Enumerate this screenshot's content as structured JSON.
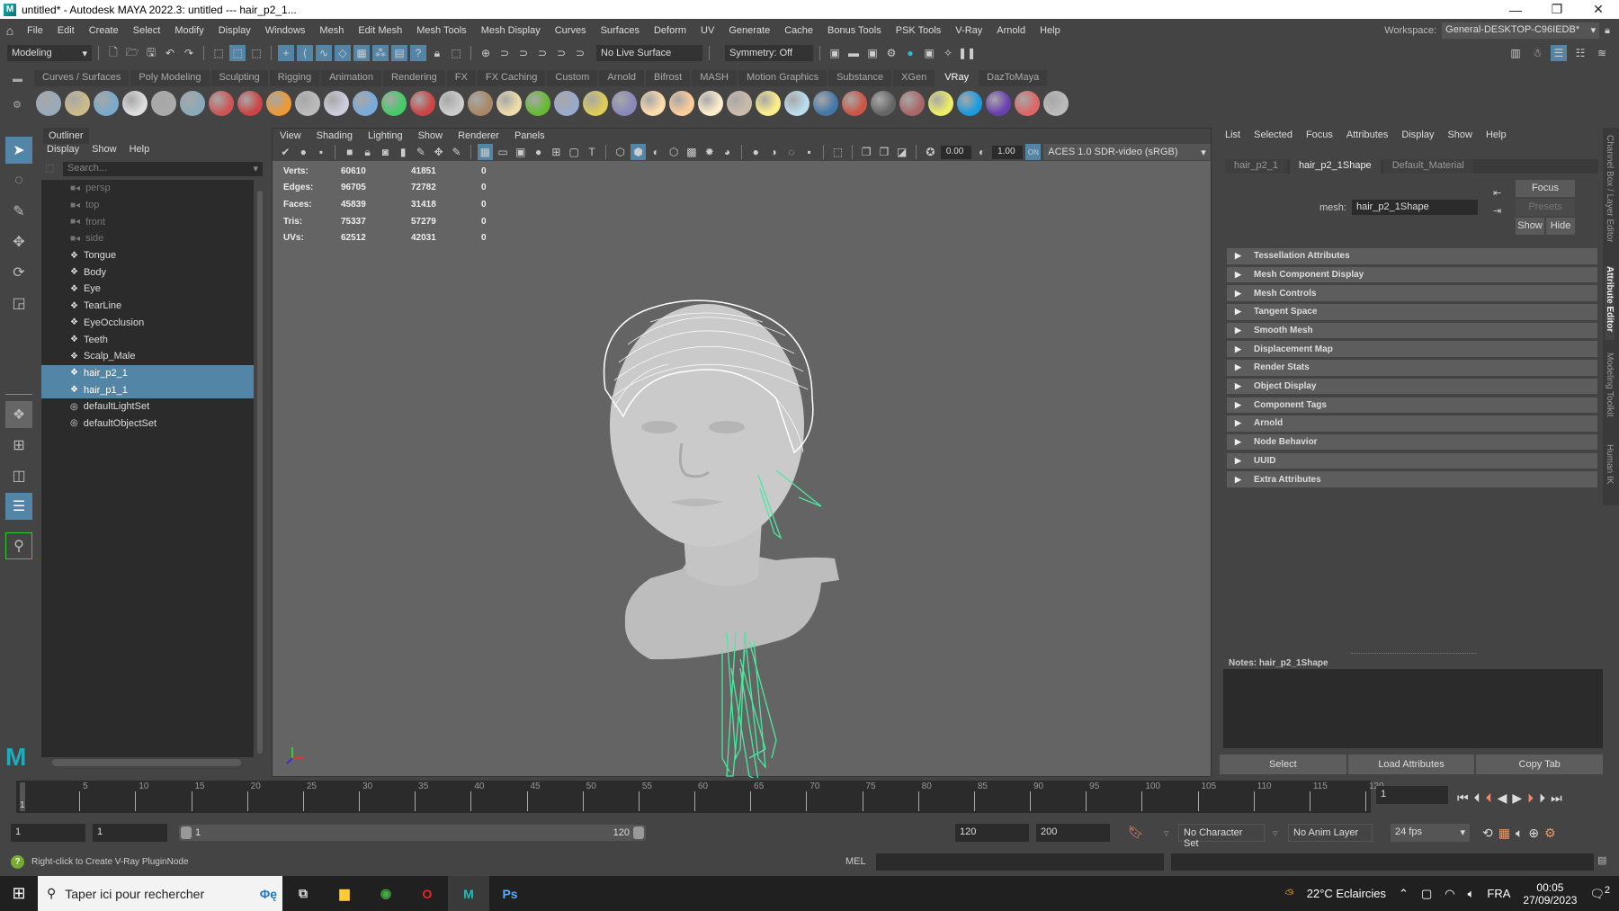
{
  "window": {
    "title": "untitled* - Autodesk MAYA 2022.3: untitled   ---   hair_p2_1...",
    "app_icon": "M",
    "controls": {
      "minimize": "—",
      "restore": "❐",
      "close": "✕"
    }
  },
  "menubar": {
    "items": [
      "File",
      "Edit",
      "Create",
      "Select",
      "Modify",
      "Display",
      "Windows",
      "Mesh",
      "Edit Mesh",
      "Mesh Tools",
      "Mesh Display",
      "Curves",
      "Surfaces",
      "Deform",
      "UV",
      "Generate",
      "Cache",
      "Bonus Tools",
      "PSK Tools",
      "V-Ray",
      "Arnold",
      "Help"
    ],
    "workspace_label": "Workspace:",
    "workspace_value": "General-DESKTOP-C96IEDB*"
  },
  "statusline": {
    "menuset": "Modeling",
    "live_surface": "No Live Surface",
    "symmetry": "Symmetry: Off"
  },
  "shelf": {
    "tabs": [
      "Curves / Surfaces",
      "Poly Modeling",
      "Sculpting",
      "Rigging",
      "Animation",
      "Rendering",
      "FX",
      "FX Caching",
      "Custom",
      "Arnold",
      "Bifrost",
      "MASH",
      "Motion Graphics",
      "Substance",
      "XGen",
      "VRay",
      "DazToMaya"
    ],
    "active_tab": "VRay",
    "icon_colors": [
      "#9ab",
      "#cb8",
      "#7ac",
      "#ddd",
      "#aaa",
      "#8ab",
      "#c55",
      "#c44",
      "#e93",
      "#bbb",
      "#ccd",
      "#7ad",
      "#4c6",
      "#c44",
      "#ccc",
      "#a86",
      "#eda",
      "#6b3",
      "#9ac",
      "#dc5",
      "#88b",
      "#fda",
      "#fc9",
      "#fec",
      "#cba",
      "#fe8",
      "#bde",
      "#47a",
      "#c54",
      "#666",
      "#a66",
      "#ee6",
      "#1a9be0",
      "#6a3fb0",
      "#d66",
      "#bbb"
    ]
  },
  "toolbox": {
    "tools": [
      {
        "name": "select-tool-icon",
        "glyph": "➤",
        "active": true
      },
      {
        "name": "lasso-tool-icon",
        "glyph": "◌"
      },
      {
        "name": "paint-select-icon",
        "glyph": "✎"
      },
      {
        "name": "move-tool-icon",
        "glyph": "✥"
      },
      {
        "name": "rotate-tool-icon",
        "glyph": "⟳"
      },
      {
        "name": "scale-tool-icon",
        "glyph": "◲"
      }
    ]
  },
  "outliner": {
    "title": "Outliner",
    "menu": [
      "Display",
      "Show",
      "Help"
    ],
    "search_placeholder": "Search...",
    "items": [
      {
        "label": "persp",
        "type": "camera",
        "dim": true
      },
      {
        "label": "top",
        "type": "camera",
        "dim": true
      },
      {
        "label": "front",
        "type": "camera",
        "dim": true
      },
      {
        "label": "side",
        "type": "camera",
        "dim": true
      },
      {
        "label": "Tongue",
        "type": "mesh"
      },
      {
        "label": "Body",
        "type": "mesh"
      },
      {
        "label": "Eye",
        "type": "mesh"
      },
      {
        "label": "TearLine",
        "type": "mesh"
      },
      {
        "label": "EyeOcclusion",
        "type": "mesh"
      },
      {
        "label": "Teeth",
        "type": "mesh"
      },
      {
        "label": "Scalp_Male",
        "type": "mesh"
      },
      {
        "label": "hair_p2_1",
        "type": "mesh",
        "selected": true
      },
      {
        "label": "hair_p1_1",
        "type": "mesh",
        "selected": true
      },
      {
        "label": "defaultLightSet",
        "type": "set"
      },
      {
        "label": "defaultObjectSet",
        "type": "set"
      }
    ]
  },
  "viewport": {
    "menu": [
      "View",
      "Shading",
      "Lighting",
      "Show",
      "Renderer",
      "Panels"
    ],
    "exposure": "0.00",
    "gamma": "1.00",
    "color_space": "ACES 1.0 SDR-video (sRGB)",
    "hud": [
      {
        "label": "Verts:",
        "a": "60610",
        "b": "41851",
        "c": "0"
      },
      {
        "label": "Edges:",
        "a": "96705",
        "b": "72782",
        "c": "0"
      },
      {
        "label": "Faces:",
        "a": "45839",
        "b": "31418",
        "c": "0"
      },
      {
        "label": "Tris:",
        "a": "75337",
        "b": "57279",
        "c": "0"
      },
      {
        "label": "UVs:",
        "a": "62512",
        "b": "42031",
        "c": "0"
      }
    ],
    "colors": {
      "background": "#646464",
      "hair_selected": "#4de8a0",
      "wire": "#ffffff",
      "skin": "#c9c9c9"
    }
  },
  "attribute_editor": {
    "menu": [
      "List",
      "Selected",
      "Focus",
      "Attributes",
      "Display",
      "Show",
      "Help"
    ],
    "tabs": [
      "hair_p2_1",
      "hair_p2_1Shape",
      "Default_Material"
    ],
    "active_tab": "hair_p2_1Shape",
    "mesh_label": "mesh:",
    "mesh_value": "hair_p2_1Shape",
    "focus": "Focus",
    "presets": "Presets",
    "show": "Show",
    "hide": "Hide",
    "sections": [
      "Tessellation Attributes",
      "Mesh Component Display",
      "Mesh Controls",
      "Tangent Space",
      "Smooth Mesh",
      "Displacement Map",
      "Render Stats",
      "Object Display",
      "Component Tags",
      "Arnold",
      "Node Behavior",
      "UUID",
      "Extra Attributes"
    ],
    "notes_label": "Notes:  hair_p2_1Shape",
    "buttons": [
      "Select",
      "Load Attributes",
      "Copy Tab"
    ]
  },
  "side_tabs": [
    "Channel Box / Layer Editor",
    "Attribute Editor",
    "Modeling Toolkit",
    "Human IK"
  ],
  "timeline": {
    "ticks": [
      "5",
      "10",
      "15",
      "20",
      "25",
      "30",
      "35",
      "40",
      "45",
      "50",
      "55",
      "60",
      "65",
      "70",
      "75",
      "80",
      "85",
      "90",
      "95",
      "100",
      "105",
      "110",
      "115",
      "120"
    ],
    "current_frame": "1",
    "current_field": "1"
  },
  "range": {
    "start": "1",
    "playback_start": "1",
    "slider_min": "1",
    "slider_max": "120",
    "playback_end": "120",
    "end": "200",
    "character_set": "No Character Set",
    "anim_layer": "No Anim Layer",
    "fps": "24 fps"
  },
  "commandline": {
    "help": "Right-click to Create V-Ray PluginNode",
    "lang": "MEL"
  },
  "taskbar": {
    "search": "Taper ici pour rechercher",
    "weather": "22°C  Eclaircies",
    "lang": "FRA",
    "time": "00:05",
    "date": "27/09/2023",
    "notifications": "2"
  }
}
